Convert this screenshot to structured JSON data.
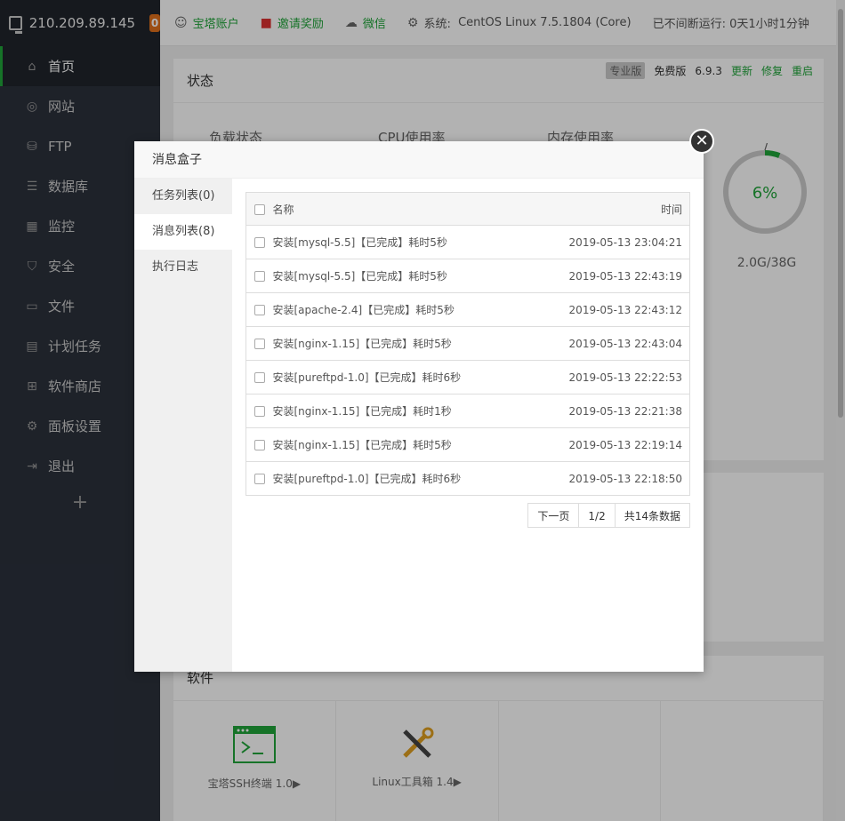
{
  "sidebar": {
    "ip": "210.209.89.145",
    "badge": "0",
    "items": [
      {
        "label": "首页",
        "icon": "home-icon"
      },
      {
        "label": "网站",
        "icon": "globe-icon"
      },
      {
        "label": "FTP",
        "icon": "ftp-icon"
      },
      {
        "label": "数据库",
        "icon": "database-icon"
      },
      {
        "label": "监控",
        "icon": "monitor-icon"
      },
      {
        "label": "安全",
        "icon": "shield-icon"
      },
      {
        "label": "文件",
        "icon": "folder-icon"
      },
      {
        "label": "计划任务",
        "icon": "calendar-icon"
      },
      {
        "label": "软件商店",
        "icon": "apps-icon"
      },
      {
        "label": "面板设置",
        "icon": "gear-icon"
      },
      {
        "label": "退出",
        "icon": "logout-icon"
      }
    ],
    "plus": "+"
  },
  "topbar": {
    "account": "宝塔账户",
    "invite": "邀请奖励",
    "wechat": "微信",
    "system_label": "系统:",
    "system_value": "CentOS Linux 7.5.1804 (Core)",
    "uptime": "已不间断运行: 0天1小时1分钟"
  },
  "status_panel": {
    "title": "状态",
    "pro": "专业版",
    "free": "免费版",
    "version": "6.9.3",
    "update": "更新",
    "repair": "修复",
    "restart": "重启",
    "load": "负载状态",
    "cpu": "CPU使用率",
    "mem": "内存使用率",
    "slash": "/",
    "disk_percent": "6%",
    "disk_percent_value": 6,
    "disk_size": "2.0G/38G"
  },
  "software_panel": {
    "title": "软件",
    "items": [
      {
        "label": "宝塔SSH终端 1.0▶"
      },
      {
        "label": "Linux工具箱 1.4▶"
      }
    ]
  },
  "modal": {
    "title": "消息盒子",
    "close": "✕",
    "tabs": [
      {
        "label": "任务列表(0)"
      },
      {
        "label": "消息列表(8)"
      },
      {
        "label": "执行日志"
      }
    ],
    "table": {
      "headers": {
        "name": "名称",
        "time": "时间"
      },
      "rows": [
        {
          "name": "安装[mysql-5.5]【已完成】耗时5秒",
          "time": "2019-05-13 23:04:21"
        },
        {
          "name": "安装[mysql-5.5]【已完成】耗时5秒",
          "time": "2019-05-13 22:43:19"
        },
        {
          "name": "安装[apache-2.4]【已完成】耗时5秒",
          "time": "2019-05-13 22:43:12"
        },
        {
          "name": "安装[nginx-1.15]【已完成】耗时5秒",
          "time": "2019-05-13 22:43:04"
        },
        {
          "name": "安装[pureftpd-1.0]【已完成】耗时6秒",
          "time": "2019-05-13 22:22:53"
        },
        {
          "name": "安装[nginx-1.15]【已完成】耗时1秒",
          "time": "2019-05-13 22:21:38"
        },
        {
          "name": "安装[nginx-1.15]【已完成】耗时5秒",
          "time": "2019-05-13 22:19:14"
        },
        {
          "name": "安装[pureftpd-1.0]【已完成】耗时6秒",
          "time": "2019-05-13 22:18:50"
        }
      ]
    },
    "pager": {
      "next": "下一页",
      "page": "1/2",
      "total": "共14条数据"
    }
  },
  "colors": {
    "accent": "#20a53a",
    "sidebar": "#2b313c",
    "badge": "#e0701c"
  }
}
